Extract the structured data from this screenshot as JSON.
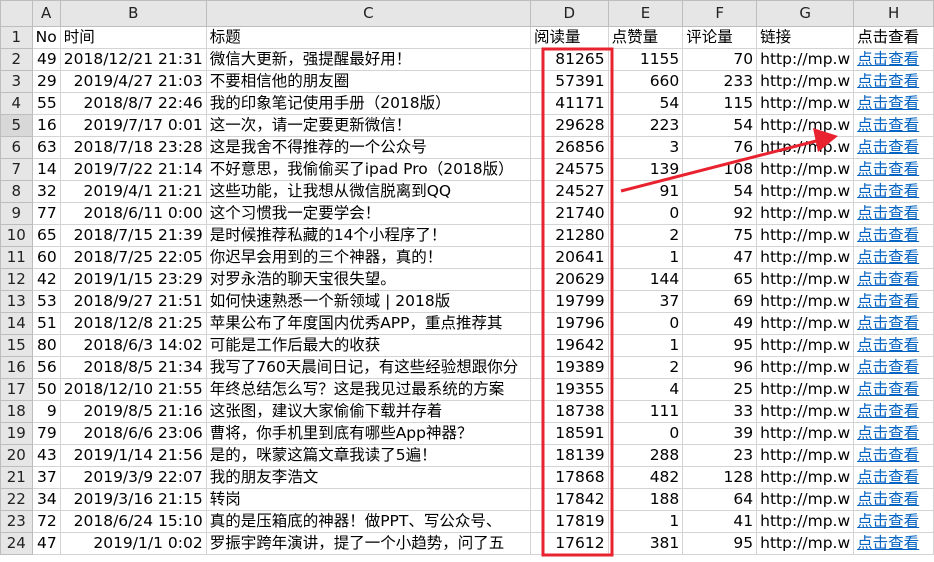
{
  "columns": [
    "A",
    "B",
    "C",
    "D",
    "E",
    "F",
    "G",
    "H"
  ],
  "headers": [
    "No",
    "时间",
    "标题",
    "阅读量",
    "点赞量",
    "评论量",
    "链接",
    "点击查看"
  ],
  "rows": [
    {
      "num": "2",
      "cells": [
        "49",
        "2018/12/21 21:31",
        "微信大更新，强提醒最好用！",
        "81265",
        "1155",
        "70",
        "http://mp.w",
        "点击查看"
      ]
    },
    {
      "num": "3",
      "cells": [
        "29",
        "2019/4/27 21:03",
        "不要相信他的朋友圈",
        "57391",
        "660",
        "233",
        "http://mp.w",
        "点击查看"
      ]
    },
    {
      "num": "4",
      "cells": [
        "55",
        "2018/8/7 22:46",
        "我的印象笔记使用手册（2018版）",
        "41171",
        "54",
        "115",
        "http://mp.w",
        "点击查看"
      ]
    },
    {
      "num": "5",
      "cells": [
        "16",
        "2019/7/17 0:01",
        "这一次，请一定要更新微信！",
        "29628",
        "223",
        "54",
        "http://mp.w",
        "点击查看"
      ]
    },
    {
      "num": "6",
      "cells": [
        "63",
        "2018/7/18 23:28",
        "这是我舍不得推荐的一个公众号",
        "26856",
        "3",
        "76",
        "http://mp.w",
        "点击查看"
      ]
    },
    {
      "num": "7",
      "cells": [
        "14",
        "2019/7/22 21:14",
        "不好意思，我偷偷买了ipad Pro（2018版）",
        "24575",
        "139",
        "108",
        "http://mp.w",
        "点击查看"
      ]
    },
    {
      "num": "8",
      "cells": [
        "32",
        "2019/4/1 21:21",
        "这些功能，让我想从微信脱离到QQ",
        "24527",
        "91",
        "54",
        "http://mp.w",
        "点击查看"
      ]
    },
    {
      "num": "9",
      "cells": [
        "77",
        "2018/6/11 0:00",
        "这个习惯我一定要学会！",
        "21740",
        "0",
        "92",
        "http://mp.w",
        "点击查看"
      ]
    },
    {
      "num": "10",
      "cells": [
        "65",
        "2018/7/15 21:39",
        "是时候推荐私藏的14个小程序了！",
        "21280",
        "2",
        "75",
        "http://mp.w",
        "点击查看"
      ]
    },
    {
      "num": "11",
      "cells": [
        "60",
        "2018/7/25 22:05",
        "你迟早会用到的三个神器，真的！",
        "20641",
        "1",
        "47",
        "http://mp.w",
        "点击查看"
      ]
    },
    {
      "num": "12",
      "cells": [
        "42",
        "2019/1/15 23:29",
        "对罗永浩的聊天宝很失望。",
        "20629",
        "144",
        "65",
        "http://mp.w",
        "点击查看"
      ]
    },
    {
      "num": "13",
      "cells": [
        "53",
        "2018/9/27 21:51",
        "如何快速熟悉一个新领域 | 2018版",
        "19799",
        "37",
        "69",
        "http://mp.w",
        "点击查看"
      ]
    },
    {
      "num": "14",
      "cells": [
        "51",
        "2018/12/8 21:25",
        "苹果公布了年度国内优秀APP，重点推荐其",
        "19796",
        "0",
        "49",
        "http://mp.w",
        "点击查看"
      ]
    },
    {
      "num": "15",
      "cells": [
        "80",
        "2018/6/3 14:02",
        "可能是工作后最大的收获",
        "19642",
        "1",
        "95",
        "http://mp.w",
        "点击查看"
      ]
    },
    {
      "num": "16",
      "cells": [
        "56",
        "2018/8/5 21:34",
        "我写了760天晨间日记，有这些经验想跟你分",
        "19389",
        "2",
        "96",
        "http://mp.w",
        "点击查看"
      ]
    },
    {
      "num": "17",
      "cells": [
        "50",
        "2018/12/10 21:55",
        "年终总结怎么写？这是我见过最系统的方案",
        "19355",
        "4",
        "25",
        "http://mp.w",
        "点击查看"
      ]
    },
    {
      "num": "18",
      "cells": [
        "9",
        "2019/8/5 21:16",
        "这张图，建议大家偷偷下载并存着",
        "18738",
        "111",
        "33",
        "http://mp.w",
        "点击查看"
      ]
    },
    {
      "num": "19",
      "cells": [
        "79",
        "2018/6/6 23:06",
        "曹将，你手机里到底有哪些App神器？",
        "18591",
        "0",
        "39",
        "http://mp.w",
        "点击查看"
      ]
    },
    {
      "num": "20",
      "cells": [
        "43",
        "2019/1/14 21:56",
        "是的，咪蒙这篇文章我读了5遍！",
        "18139",
        "288",
        "23",
        "http://mp.w",
        "点击查看"
      ]
    },
    {
      "num": "21",
      "cells": [
        "37",
        "2019/3/9 22:07",
        "我的朋友李浩文",
        "17868",
        "482",
        "128",
        "http://mp.w",
        "点击查看"
      ]
    },
    {
      "num": "22",
      "cells": [
        "34",
        "2019/3/16 21:15",
        "转岗",
        "17842",
        "188",
        "64",
        "http://mp.w",
        "点击查看"
      ]
    },
    {
      "num": "23",
      "cells": [
        "72",
        "2018/6/24 15:10",
        "真的是压箱底的神器！做PPT、写公众号、",
        "17819",
        "1",
        "41",
        "http://mp.w",
        "点击查看"
      ]
    },
    {
      "num": "24",
      "cells": [
        "47",
        "2019/1/1 0:02",
        "罗振宇跨年演讲，提了一个小趋势，问了五",
        "17612",
        "381",
        "95",
        "http://mp.w",
        "点击查看"
      ]
    }
  ],
  "selected_row": "5",
  "accent_colors": {
    "highlight": "#e8232f",
    "link": "#0563c1",
    "header_bg": "#e6e6e6"
  }
}
